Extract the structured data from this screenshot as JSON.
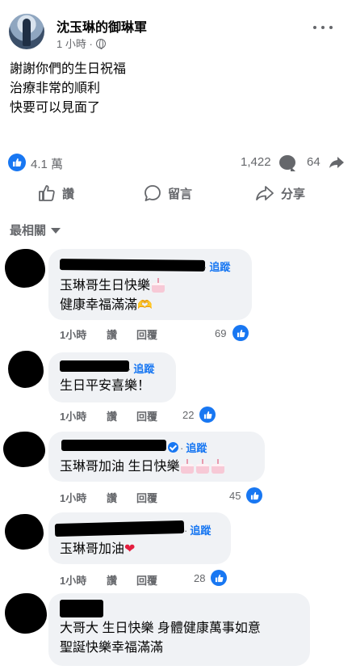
{
  "post": {
    "page_name": "沈玉琳的御琳軍",
    "time": "1 小時 ·",
    "lines": [
      "謝謝你們的生日祝福",
      "治療非常的順利",
      "快要可以見面了"
    ],
    "reactions": "4.1 萬",
    "comments": "1,422",
    "shares": "64"
  },
  "actions": {
    "like": "讚",
    "comment": "留言",
    "share": "分享"
  },
  "sort_label": "最相關",
  "comment_labels": {
    "follow": "追蹤",
    "like": "讚",
    "reply": "回覆",
    "dot": "·"
  },
  "comments": [
    {
      "lines": [
        "玉琳哥生日快樂",
        "健康幸福滿滿"
      ],
      "time": "1小時",
      "likes": "69"
    },
    {
      "lines": [
        "生日平安喜樂！"
      ],
      "time": "1小時",
      "likes": "22"
    },
    {
      "lines": [
        "玉琳哥加油 生日快樂"
      ],
      "time": "1小時",
      "likes": "45"
    },
    {
      "lines": [
        "玉琳哥加油"
      ],
      "time": "1小時",
      "likes": "28"
    },
    {
      "lines": [
        "大哥大 生日快樂 身體健康萬事如意",
        "聖誕快樂幸福滿滿"
      ]
    }
  ],
  "colors": {
    "accent": "#1877f2",
    "muted": "#65676b",
    "bubble": "#f0f2f5",
    "heart": "#e41e3f"
  },
  "icons": [
    "globe-icon",
    "more-icon",
    "like-icon",
    "comment-icon",
    "share-icon",
    "verified-icon",
    "cake-emoji",
    "heart-emoji",
    "hands-emoji"
  ]
}
